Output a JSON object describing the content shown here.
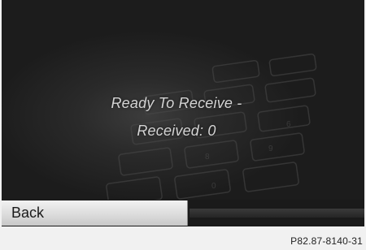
{
  "screen": {
    "message_line1": "Ready To Receive -",
    "message_line2": "Received: 0"
  },
  "bottom_bar": {
    "back_label": "Back"
  },
  "figure_caption": "P82.87-8140-31"
}
